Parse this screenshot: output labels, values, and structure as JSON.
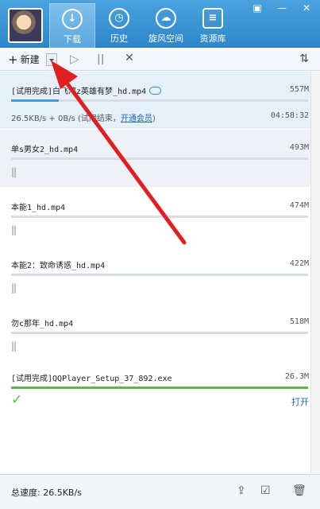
{
  "window": {
    "skin_icon": "skin-icon",
    "minimize_label": "—",
    "close_label": "✕"
  },
  "nav": {
    "tabs": [
      {
        "label": "下载",
        "icon": "download-icon",
        "active": true
      },
      {
        "label": "历史",
        "icon": "history-icon",
        "active": false
      },
      {
        "label": "旋风空间",
        "icon": "cloud-space-icon",
        "active": false
      },
      {
        "label": "资源库",
        "icon": "library-icon",
        "active": false
      }
    ]
  },
  "toolbar": {
    "new_label": "新建",
    "plus_glyph": "+",
    "play_glyph": "▷",
    "pause_glyph": "||",
    "delete_glyph": "✕",
    "sort_glyph": "⇅"
  },
  "tasks": [
    {
      "name": "[试用完成]白飞鸿z英雄有梦_hd.mp4",
      "size": "557M",
      "progress": 0.16,
      "speed_status": "26.5KB/s + 0B/s (试用结束，",
      "link": "开通会员",
      "status_close": ")",
      "time_left": "04:58:32"
    },
    {
      "name": "单s男女2_hd.mp4",
      "size": "493M",
      "progress": 0.0,
      "pause_glyph": "||"
    },
    {
      "name": "本能1_hd.mp4",
      "size": "474M",
      "progress": 0.0,
      "pause_glyph": "||"
    },
    {
      "name": "本能2：致命诱惑_hd.mp4",
      "size": "422M",
      "progress": 0.0,
      "pause_glyph": "||"
    },
    {
      "name": "勿c那年_hd.mp4",
      "size": "518M",
      "progress": 0.0,
      "pause_glyph": "||"
    },
    {
      "name": "[试用完成]QQPlayer_Setup_37_892.exe",
      "size": "26.3M",
      "progress": 1.0,
      "check_glyph": "✓",
      "open_label": "打开"
    }
  ],
  "footer": {
    "total_speed": "总速度: 26.5KB/s",
    "share_glyph": "⇪",
    "select_glyph": "☑",
    "trash_glyph": "🗑"
  },
  "colors": {
    "header": "#2d86c9",
    "accent": "#1a66b3",
    "progress_blue": "#3c9ee1",
    "progress_green": "#5db645",
    "annotation_arrow": "#e02020"
  }
}
